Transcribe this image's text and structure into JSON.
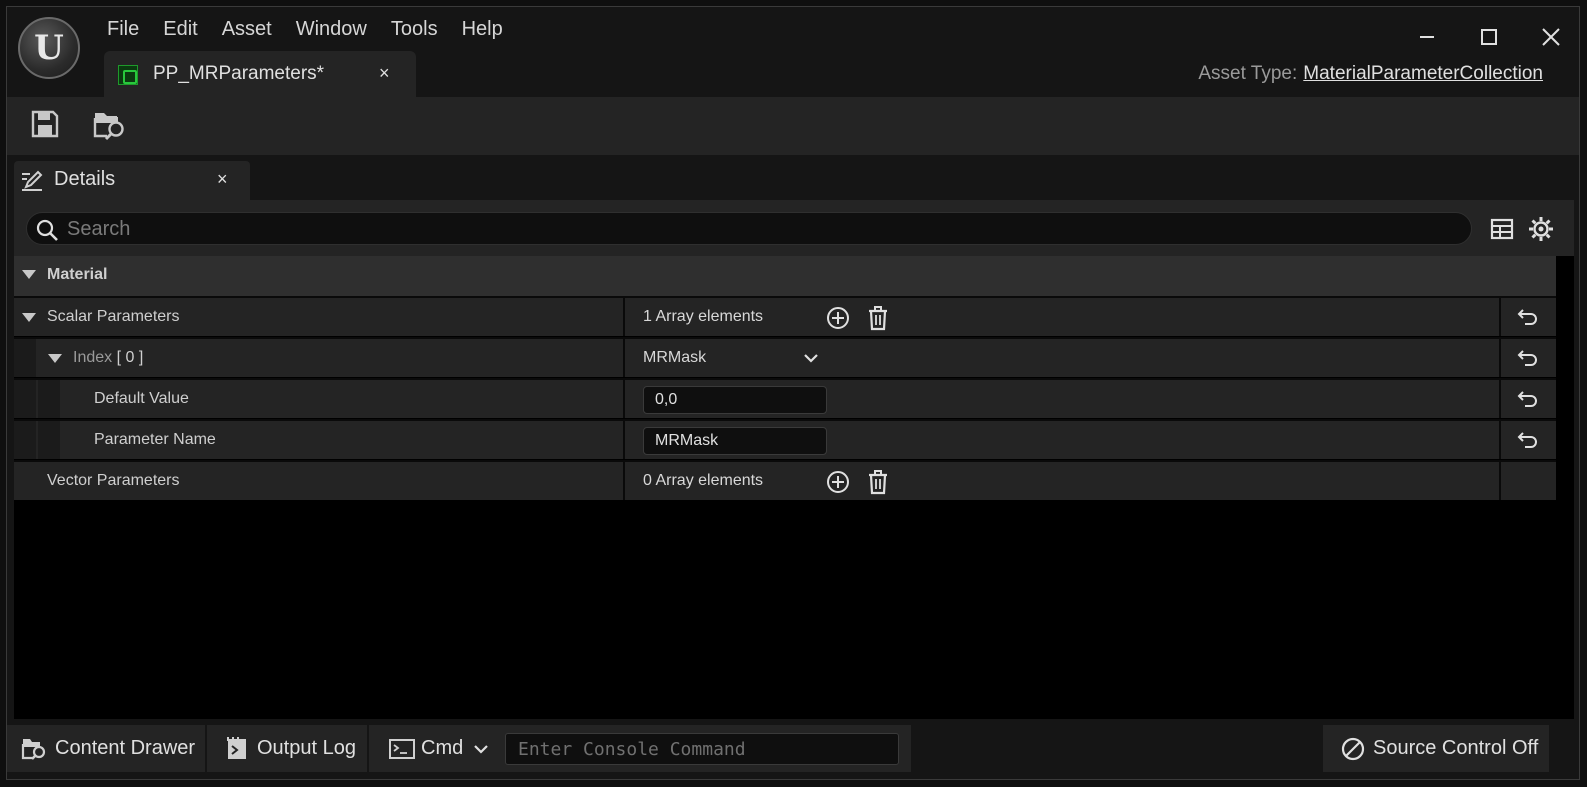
{
  "menu": [
    "File",
    "Edit",
    "Asset",
    "Window",
    "Tools",
    "Help"
  ],
  "logo": {
    "letter": "U"
  },
  "doc_tab": {
    "label": "PP_MRParameters*",
    "close": "×"
  },
  "window_controls": {
    "minimize": "—",
    "maximize": "☐",
    "close": "✕"
  },
  "asset_type": {
    "label": "Asset Type:",
    "value": "MaterialParameterCollection"
  },
  "details_tab": {
    "label": "Details",
    "close": "×"
  },
  "search": {
    "placeholder": "Search"
  },
  "category": {
    "label": "Material"
  },
  "rows": {
    "scalar": {
      "label": "Scalar Parameters",
      "value": "1 Array elements"
    },
    "index": {
      "label": "Index",
      "bracket": "[ 0 ]",
      "value": "MRMask"
    },
    "default_value": {
      "label": "Default Value",
      "value": "0,0"
    },
    "parameter_name": {
      "label": "Parameter Name",
      "value": "MRMask"
    },
    "vector": {
      "label": "Vector Parameters",
      "value": "0 Array elements"
    }
  },
  "status": {
    "content_drawer": "Content Drawer",
    "output_log": "Output Log",
    "cmd": "Cmd",
    "console_placeholder": "Enter Console Command",
    "source_control": "Source Control Off"
  },
  "colors": {
    "background": "#151515",
    "panel": "#242424",
    "accent_green": "#28c83c"
  }
}
